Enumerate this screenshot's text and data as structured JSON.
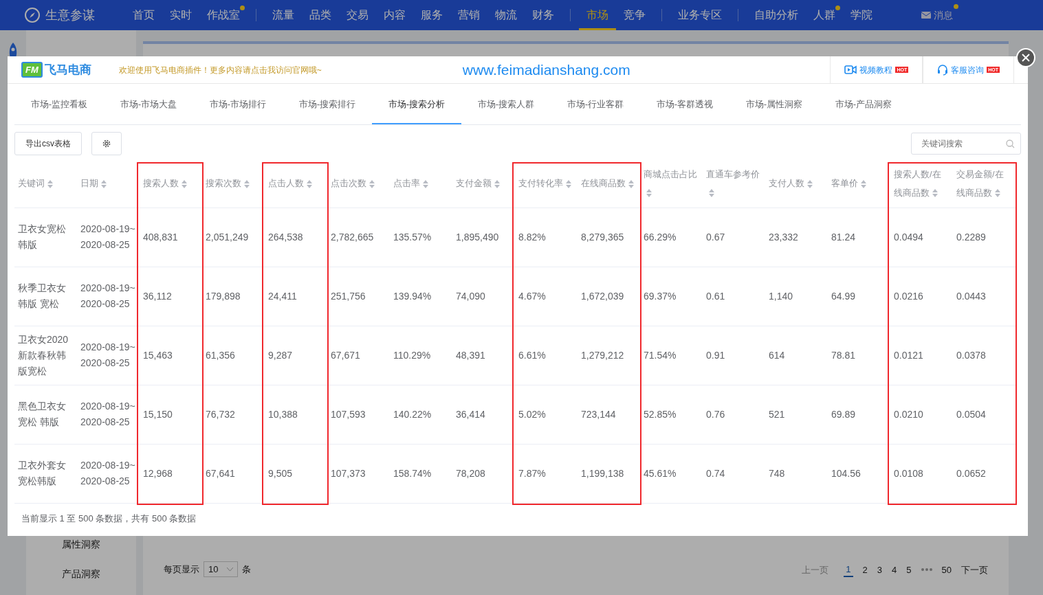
{
  "nav": {
    "logo": "生意参谋",
    "groups": [
      [
        {
          "label": "首页",
          "dot": false,
          "selected": false
        },
        {
          "label": "实时",
          "dot": false,
          "selected": false
        },
        {
          "label": "作战室",
          "dot": true,
          "selected": false
        }
      ],
      [
        {
          "label": "流量",
          "dot": false,
          "selected": false
        },
        {
          "label": "品类",
          "dot": false,
          "selected": false
        },
        {
          "label": "交易",
          "dot": false,
          "selected": false
        },
        {
          "label": "内容",
          "dot": false,
          "selected": false
        },
        {
          "label": "服务",
          "dot": false,
          "selected": false
        },
        {
          "label": "营销",
          "dot": false,
          "selected": false
        },
        {
          "label": "物流",
          "dot": false,
          "selected": false
        },
        {
          "label": "财务",
          "dot": false,
          "selected": false
        }
      ],
      [
        {
          "label": "市场",
          "dot": false,
          "selected": true
        },
        {
          "label": "竞争",
          "dot": false,
          "selected": false
        }
      ],
      [
        {
          "label": "业务专区",
          "dot": false,
          "selected": false
        }
      ],
      [
        {
          "label": "自助分析",
          "dot": false,
          "selected": false
        },
        {
          "label": "人群",
          "dot": true,
          "selected": false
        },
        {
          "label": "学院",
          "dot": false,
          "selected": false
        }
      ]
    ],
    "message": {
      "label": "消息",
      "dot": true
    }
  },
  "background": {
    "sidebar_items": [
      "属性洞察",
      "产品洞察"
    ],
    "page_size": {
      "label": "每页显示",
      "value": "10",
      "unit": "条"
    },
    "pagination": {
      "prev": "上一页",
      "pages": [
        {
          "label": "1",
          "selected": true
        },
        {
          "label": "2",
          "selected": false
        },
        {
          "label": "3",
          "selected": false
        },
        {
          "label": "4",
          "selected": false
        },
        {
          "label": "5",
          "selected": false
        },
        {
          "label": "50",
          "selected": false
        }
      ],
      "next": "下一页"
    }
  },
  "modal": {
    "logo_mark": "FM",
    "brand": "飞马电商",
    "welcome": "欢迎使用飞马电商插件！更多内容请点击我访问官网哦~",
    "url": "www.feimadianshang.com",
    "links": [
      {
        "label": "视频教程",
        "badge": "HOT"
      },
      {
        "label": "客服咨询",
        "badge": "HOT"
      }
    ],
    "tabs": [
      {
        "label": "市场-监控看板",
        "selected": false
      },
      {
        "label": "市场-市场大盘",
        "selected": false
      },
      {
        "label": "市场-市场排行",
        "selected": false
      },
      {
        "label": "市场-搜索排行",
        "selected": false
      },
      {
        "label": "市场-搜索分析",
        "selected": true
      },
      {
        "label": "市场-搜索人群",
        "selected": false
      },
      {
        "label": "市场-行业客群",
        "selected": false
      },
      {
        "label": "市场-客群透视",
        "selected": false
      },
      {
        "label": "市场-属性洞察",
        "selected": false
      },
      {
        "label": "市场-产品洞察",
        "selected": false
      }
    ],
    "export_button": "导出csv表格",
    "search": {
      "placeholder": "关键词搜索"
    },
    "table": {
      "columns": [
        {
          "label": "关键词",
          "highlighted": false
        },
        {
          "label": "日期",
          "highlighted": false
        },
        {
          "label": "搜索人数",
          "highlighted": true
        },
        {
          "label": "搜索次数",
          "highlighted": false
        },
        {
          "label": "点击人数",
          "highlighted": true
        },
        {
          "label": "点击次数",
          "highlighted": false
        },
        {
          "label": "点击率",
          "highlighted": false
        },
        {
          "label": "支付金额",
          "highlighted": false
        },
        {
          "label": "支付转化率",
          "highlighted": true
        },
        {
          "label": "在线商品数",
          "highlighted": true
        },
        {
          "label": "商城点击占比",
          "highlighted": false
        },
        {
          "label": "直通车参考价",
          "highlighted": false
        },
        {
          "label": "支付人数",
          "highlighted": false
        },
        {
          "label": "客单价",
          "highlighted": false
        },
        {
          "label": "搜索人数/在线商品数",
          "highlighted": true
        },
        {
          "label": "交易金额/在线商品数",
          "highlighted": true
        }
      ],
      "rows": [
        [
          "卫衣女宽松韩版",
          "2020-08-19~2020-08-25",
          "408,831",
          "2,051,249",
          "264,538",
          "2,782,665",
          "135.57%",
          "1,895,490",
          "8.82%",
          "8,279,365",
          "66.29%",
          "0.67",
          "23,332",
          "81.24",
          "0.0494",
          "0.2289"
        ],
        [
          "秋季卫衣女韩版 宽松",
          "2020-08-19~2020-08-25",
          "36,112",
          "179,898",
          "24,411",
          "251,756",
          "139.94%",
          "74,090",
          "4.67%",
          "1,672,039",
          "69.37%",
          "0.61",
          "1,140",
          "64.99",
          "0.0216",
          "0.0443"
        ],
        [
          "卫衣女2020新款春秋韩版宽松",
          "2020-08-19~2020-08-25",
          "15,463",
          "61,356",
          "9,287",
          "67,671",
          "110.29%",
          "48,391",
          "6.61%",
          "1,279,212",
          "71.54%",
          "0.91",
          "614",
          "78.81",
          "0.0121",
          "0.0378"
        ],
        [
          "黑色卫衣女宽松 韩版",
          "2020-08-19~2020-08-25",
          "15,150",
          "76,732",
          "10,388",
          "107,593",
          "140.22%",
          "36,414",
          "5.02%",
          "723,144",
          "52.85%",
          "0.76",
          "521",
          "69.89",
          "0.0210",
          "0.0504"
        ],
        [
          "卫衣外套女宽松韩版",
          "2020-08-19~2020-08-25",
          "12,968",
          "67,641",
          "9,505",
          "107,373",
          "158.74%",
          "78,208",
          "7.87%",
          "1,199,138",
          "45.61%",
          "0.74",
          "748",
          "104.56",
          "0.0108",
          "0.0652"
        ]
      ]
    },
    "summary": "当前显示 1 至 500 条数据，共有 500 条数据"
  }
}
